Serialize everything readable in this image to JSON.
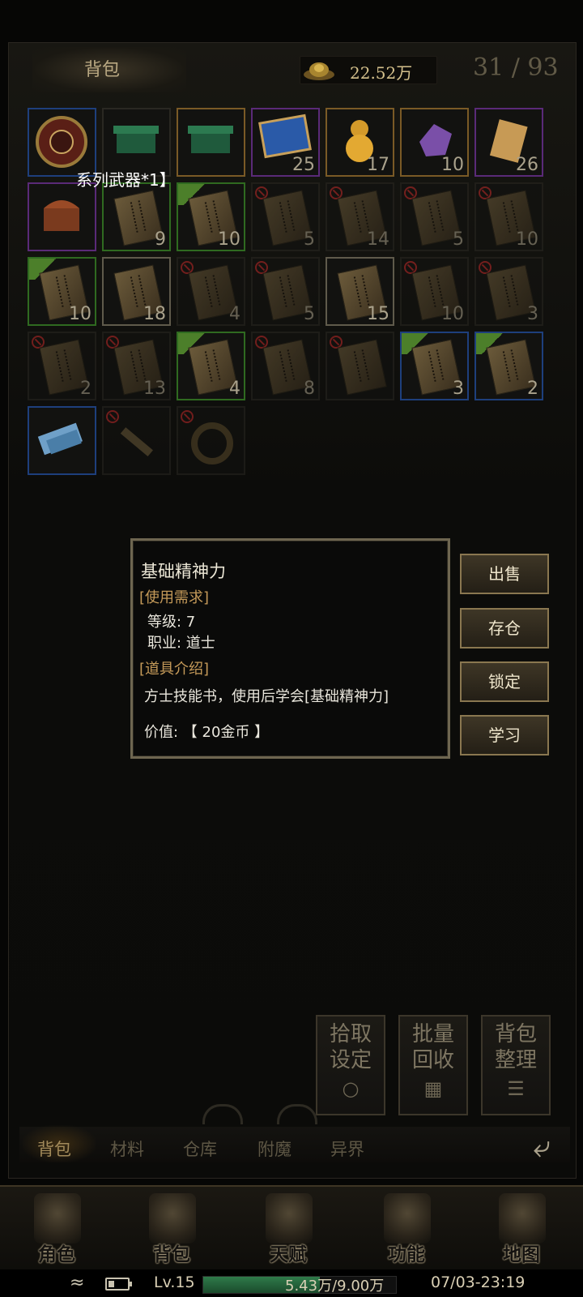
{
  "header": {
    "title": "背包",
    "gold": "22.52万",
    "capacity": "31 / 93"
  },
  "floating_label": "系列武器*1】",
  "inventory": {
    "row1": [
      "",
      "",
      "",
      "25",
      "17",
      "10",
      "26"
    ],
    "row2": [
      "",
      "9",
      "10",
      "5",
      "14",
      "5",
      "10"
    ],
    "row3": [
      "10",
      "18",
      "4",
      "5",
      "15",
      "10",
      "3"
    ],
    "row4": [
      "2",
      "13",
      "4",
      "8",
      "",
      "3",
      "2"
    ],
    "row5": [
      "",
      "",
      ""
    ]
  },
  "tooltip": {
    "name": "基础精神力",
    "req_header": "[使用需求]",
    "level": "等级: 7",
    "class": "职业: 道士",
    "intro_header": "[道具介绍]",
    "desc": "方士技能书，使用后学会[基础精神力]",
    "value": "价值: 【 20金币 】"
  },
  "actions": {
    "sell": "出售",
    "store": "存仓",
    "lock": "锁定",
    "learn": "学习"
  },
  "bottom_buttons": {
    "pickup_l1": "拾取",
    "pickup_l2": "设定",
    "recycle_l1": "批量",
    "recycle_l2": "回收",
    "sort_l1": "背包",
    "sort_l2": "整理"
  },
  "tabs": [
    "背包",
    "材料",
    "仓库",
    "附魔",
    "异界"
  ],
  "nav": [
    "角色",
    "背包",
    "天赋",
    "功能",
    "地图"
  ],
  "status": {
    "level": "Lv.15",
    "exp_text": "5.43万/9.00万",
    "exp_progress": 0.603,
    "datetime": "07/03-23:19"
  },
  "colors": {
    "tooltip_header": "#c59a59",
    "exp_fill": "#2f7a4a"
  }
}
